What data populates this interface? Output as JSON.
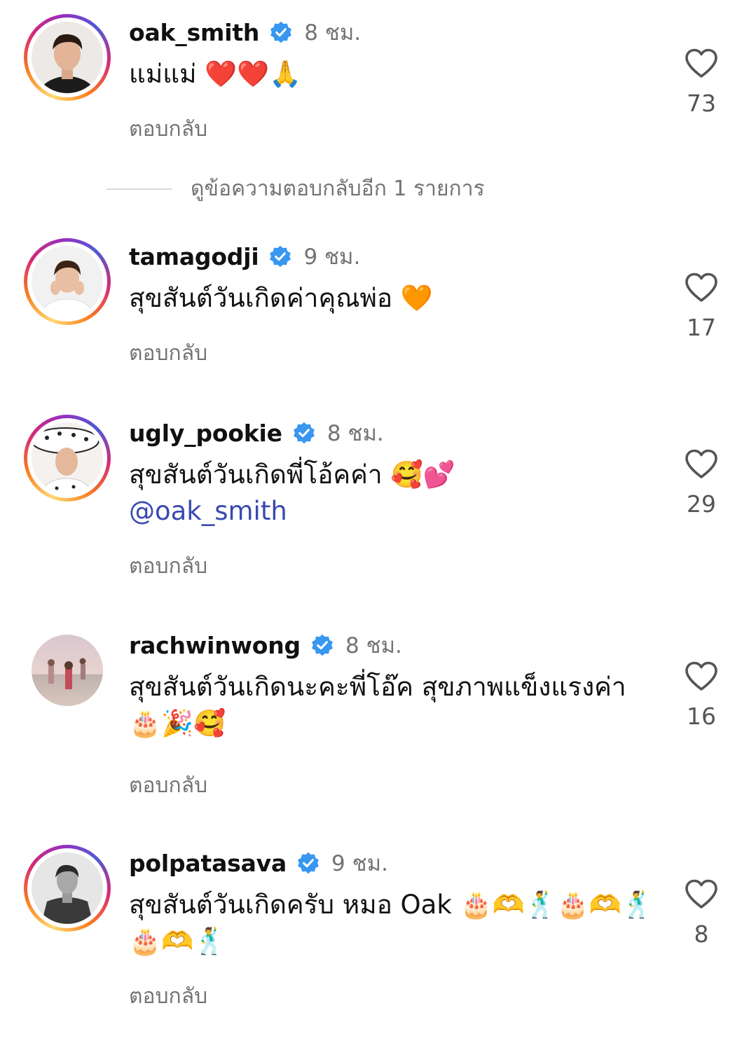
{
  "comments": [
    {
      "username": "oak_smith",
      "verified": true,
      "time": "8 ชม.",
      "text": "แม่แม่ ❤️❤️🙏",
      "mention": "",
      "reply_label": "ตอบกลับ",
      "like_count": "73",
      "story_ring": true
    },
    {
      "username": "tamagodji",
      "verified": true,
      "time": "9 ชม.",
      "text": "สุขสันต์วันเกิดค่าคุณพ่อ 🧡",
      "mention": "",
      "reply_label": "ตอบกลับ",
      "like_count": "17",
      "story_ring": true
    },
    {
      "username": "ugly_pookie",
      "verified": true,
      "time": "8 ชม.",
      "text": "สุขสันต์วันเกิดพี่โอ้คค่า 🥰💕",
      "mention": "@oak_smith",
      "reply_label": "ตอบกลับ",
      "like_count": "29",
      "story_ring": true
    },
    {
      "username": "rachwinwong",
      "verified": true,
      "time": "8 ชม.",
      "text": "สุขสันต์วันเกิดนะคะพี่โอ๊ค สุขภาพแข็งแรงค่า🎂🎉🥰",
      "mention": "",
      "reply_label": "ตอบกลับ",
      "like_count": "16",
      "story_ring": false
    },
    {
      "username": "polpatasava",
      "verified": true,
      "time": "9 ชม.",
      "text": "สุขสันต์วันเกิดครับ หมอ  Oak 🎂🫶🕺🎂🫶🕺🎂🫶🕺",
      "mention": "",
      "reply_label": "ตอบกลับ",
      "like_count": "8",
      "story_ring": true
    }
  ],
  "view_replies": {
    "label": "ดูข้อความตอบกลับอีก 1 รายการ"
  },
  "colors": {
    "verified": "#3897f0",
    "mention": "#3a49b0",
    "secondary_text": "#737373"
  },
  "icons": {
    "verified": "verified-badge-icon",
    "like": "heart-outline-icon"
  }
}
